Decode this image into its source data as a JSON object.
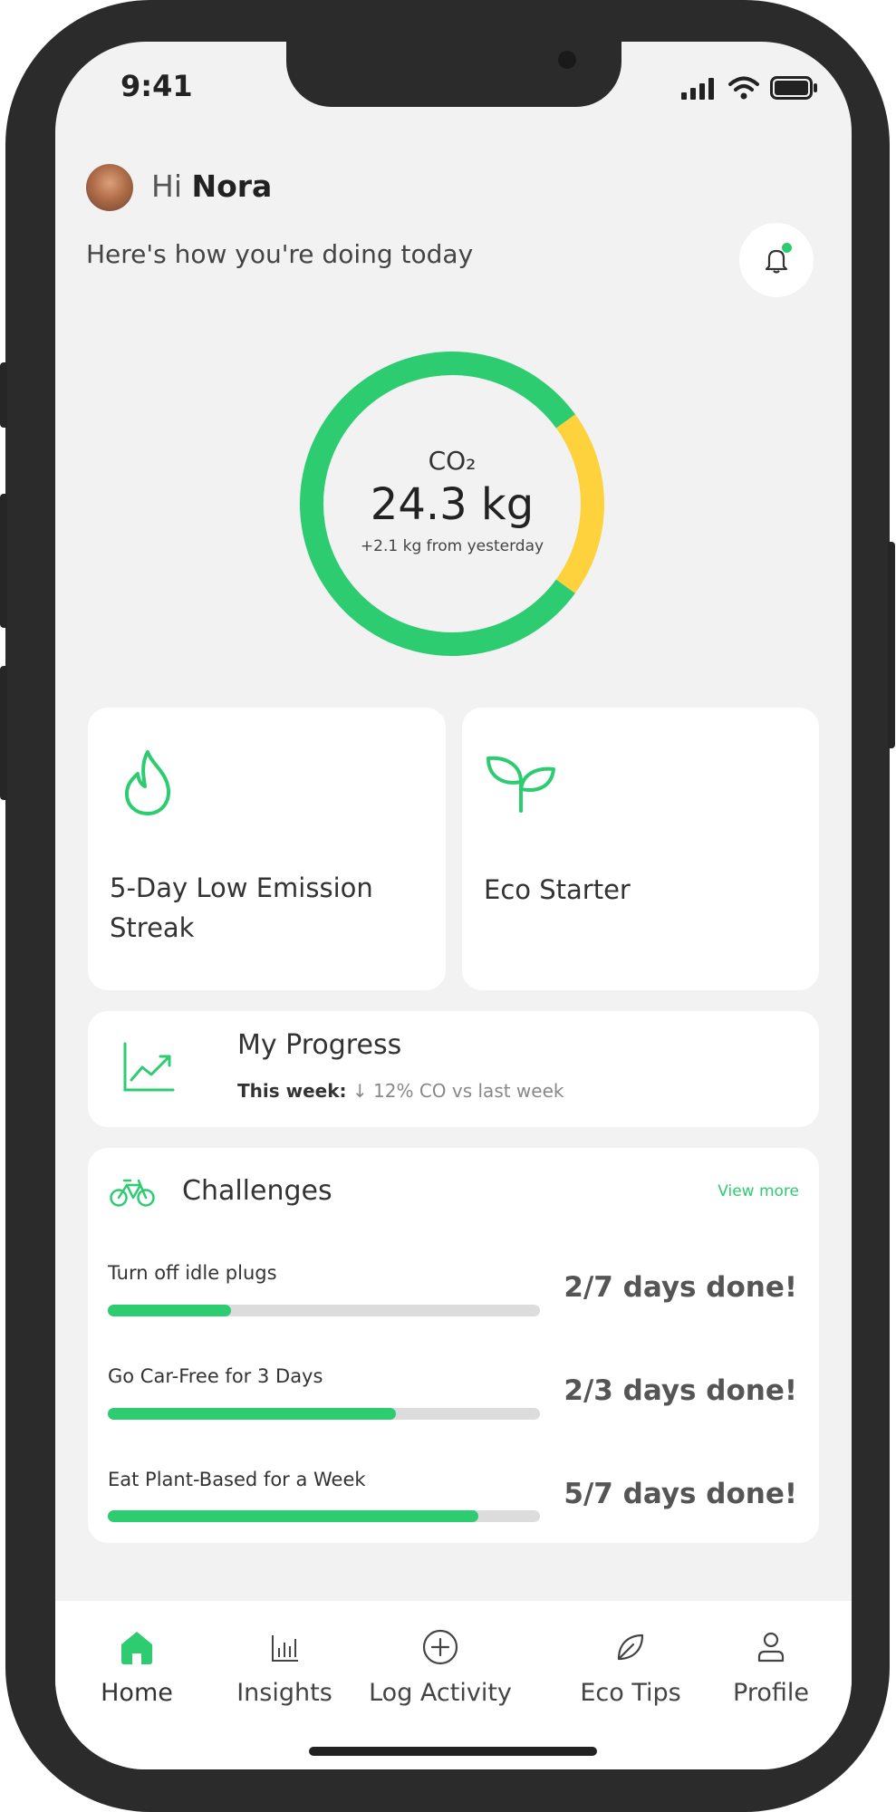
{
  "status_bar": {
    "time": "9:41"
  },
  "header": {
    "greeting_prefix": "Hi",
    "user_name": "Nora",
    "subtitle": "Here's how you're doing today"
  },
  "emissions": {
    "label": "CO₂",
    "value": "24.3 kg",
    "delta": "+2.1 kg from yesterday",
    "ring_green_fraction": 0.8,
    "ring_yellow_fraction": 0.2
  },
  "achievements": [
    {
      "title": "5-Day Low Emission Streak",
      "icon": "flame-icon"
    },
    {
      "title": "Eco Starter",
      "icon": "sprout-icon"
    }
  ],
  "progress": {
    "title": "My Progress",
    "label": "This week:",
    "arrow": "↓",
    "value": "12%",
    "unit": "CO",
    "comparison": "vs last week"
  },
  "challenges": {
    "title": "Challenges",
    "view_more": "View more",
    "items": [
      {
        "name": "Turn off idle plugs",
        "status": "2/7 days done!",
        "progress": 0.2857
      },
      {
        "name": "Go Car-Free for 3 Days",
        "status": "2/3 days done!",
        "progress": 0.6667
      },
      {
        "name": "Eat Plant-Based for a Week",
        "status": "5/7 days done!",
        "progress": 0.8571
      }
    ]
  },
  "nav": [
    {
      "label": "Home",
      "icon": "home-icon",
      "active": true
    },
    {
      "label": "Insights",
      "icon": "bar-chart-icon",
      "active": false
    },
    {
      "label": "Log Activity",
      "icon": "plus-circle-icon",
      "active": false
    },
    {
      "label": "Eco Tips",
      "icon": "leaf-icon",
      "active": false
    },
    {
      "label": "Profile",
      "icon": "user-icon",
      "active": false
    }
  ],
  "colors": {
    "accent": "#2ecc71",
    "warning": "#fdd23c",
    "background": "#f2f2f2",
    "frame": "#2b2b2b"
  }
}
